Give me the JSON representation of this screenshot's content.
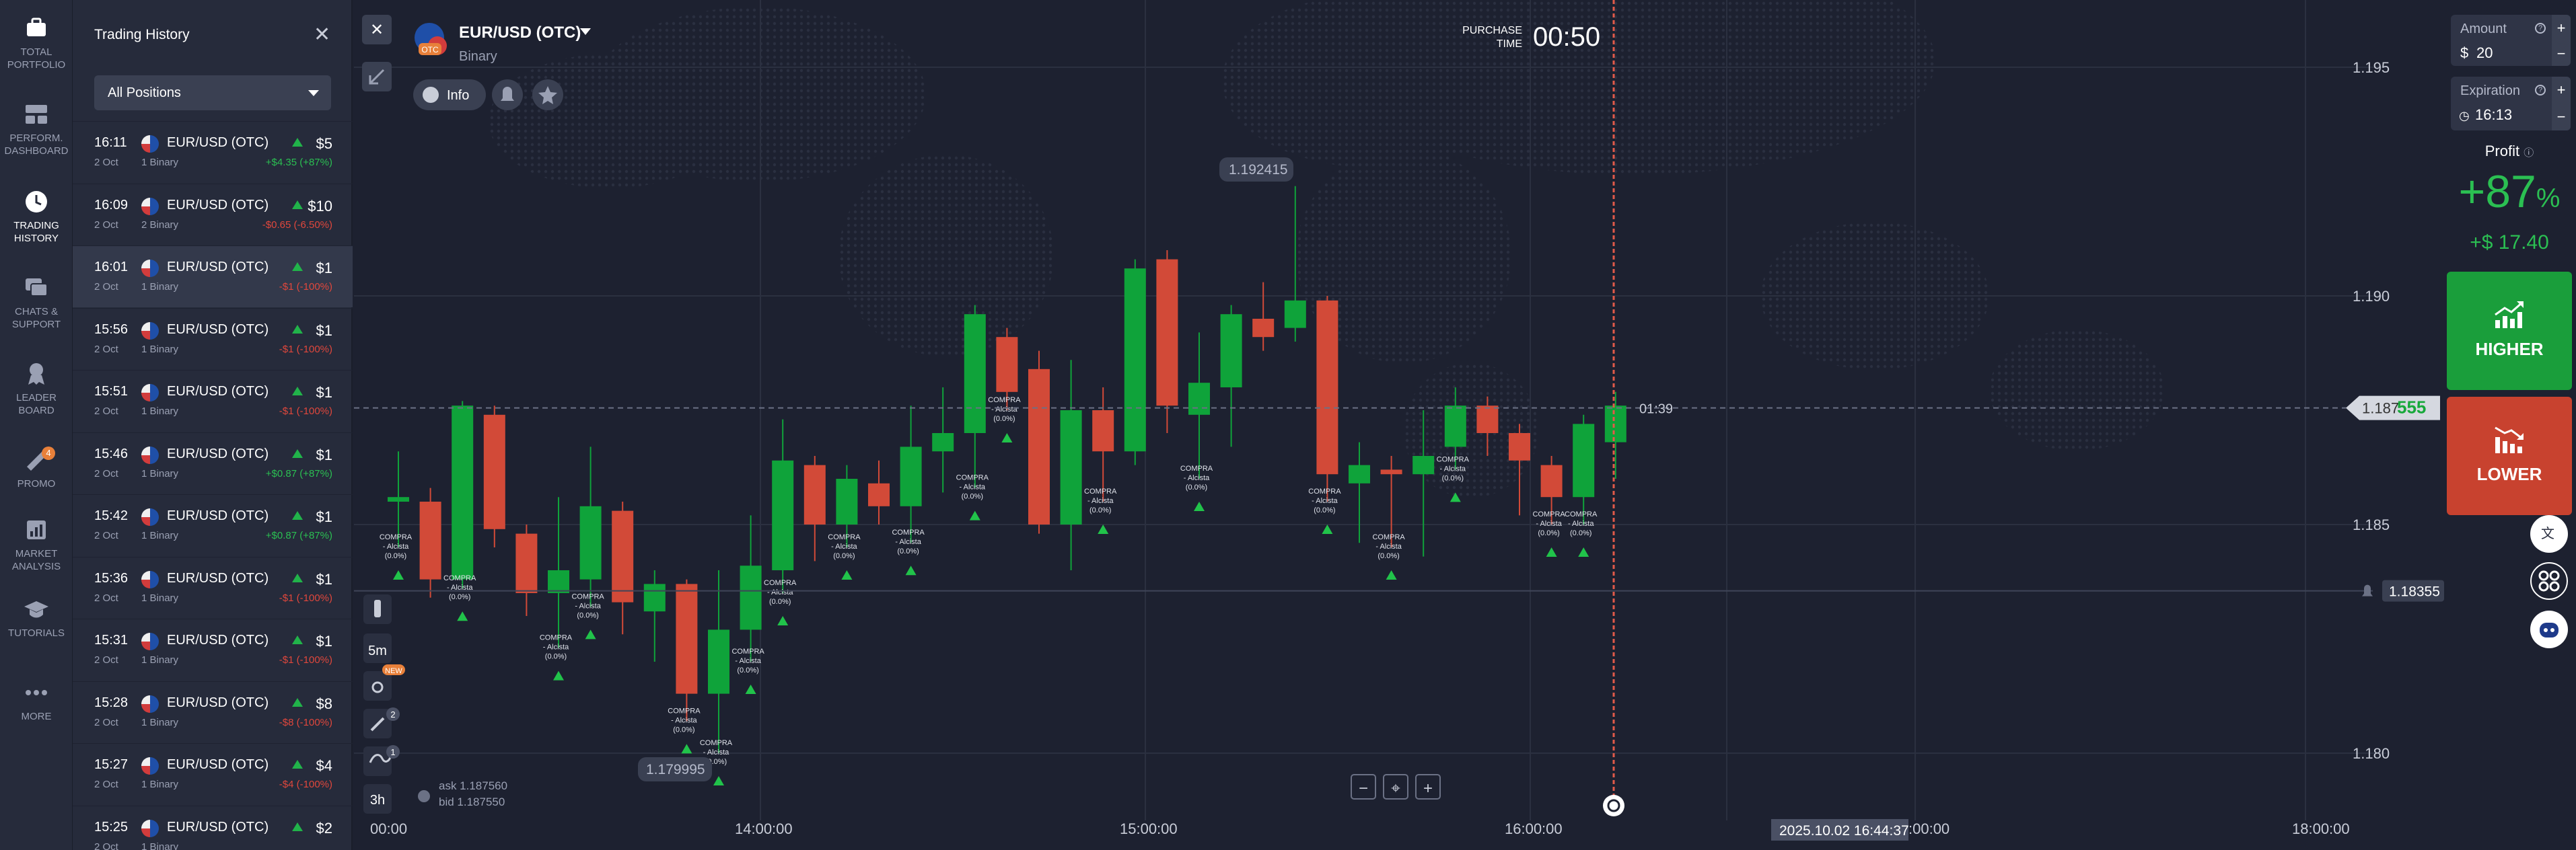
{
  "nav": {
    "items": [
      {
        "label1": "TOTAL",
        "label2": "PORTFOLIO",
        "icon": "briefcase-icon"
      },
      {
        "label1": "PERFORM.",
        "label2": "DASHBOARD",
        "icon": "dashboard-icon"
      },
      {
        "label1": "TRADING",
        "label2": "HISTORY",
        "icon": "clock-icon",
        "active": true
      },
      {
        "label1": "CHATS &",
        "label2": "SUPPORT",
        "icon": "chat-icon"
      },
      {
        "label1": "LEADER",
        "label2": "BOARD",
        "icon": "leaderboard-icon"
      },
      {
        "label1": "PROMO",
        "label2": "",
        "icon": "promo-icon",
        "badge": "4"
      },
      {
        "label1": "MARKET",
        "label2": "ANALYSIS",
        "icon": "analysis-icon"
      },
      {
        "label1": "TUTORIALS",
        "label2": "",
        "icon": "graduation-cap-icon"
      },
      {
        "label1": "MORE",
        "label2": "",
        "icon": "more-dots-icon"
      }
    ]
  },
  "history": {
    "title": "Trading History",
    "close": "✕",
    "filter": "All Positions",
    "rows": [
      {
        "time": "16:11",
        "date": "2 Oct",
        "pair": "EUR/USD (OTC)",
        "kind": "1 Binary",
        "amount": "$5",
        "result": "+$4.35 (+87%)",
        "positive": true
      },
      {
        "time": "16:09",
        "date": "2 Oct",
        "pair": "EUR/USD (OTC)",
        "kind": "2 Binary",
        "amount": "$10",
        "result": "-$0.65 (-6.50%)",
        "positive": false
      },
      {
        "time": "16:01",
        "date": "2 Oct",
        "pair": "EUR/USD (OTC)",
        "kind": "1 Binary",
        "amount": "$1",
        "result": "-$1 (-100%)",
        "positive": false,
        "selected": true
      },
      {
        "time": "15:56",
        "date": "2 Oct",
        "pair": "EUR/USD (OTC)",
        "kind": "1 Binary",
        "amount": "$1",
        "result": "-$1 (-100%)",
        "positive": false
      },
      {
        "time": "15:51",
        "date": "2 Oct",
        "pair": "EUR/USD (OTC)",
        "kind": "1 Binary",
        "amount": "$1",
        "result": "-$1 (-100%)",
        "positive": false
      },
      {
        "time": "15:46",
        "date": "2 Oct",
        "pair": "EUR/USD (OTC)",
        "kind": "1 Binary",
        "amount": "$1",
        "result": "+$0.87 (+87%)",
        "positive": true
      },
      {
        "time": "15:42",
        "date": "2 Oct",
        "pair": "EUR/USD (OTC)",
        "kind": "1 Binary",
        "amount": "$1",
        "result": "+$0.87 (+87%)",
        "positive": true
      },
      {
        "time": "15:36",
        "date": "2 Oct",
        "pair": "EUR/USD (OTC)",
        "kind": "1 Binary",
        "amount": "$1",
        "result": "-$1 (-100%)",
        "positive": false
      },
      {
        "time": "15:31",
        "date": "2 Oct",
        "pair": "EUR/USD (OTC)",
        "kind": "1 Binary",
        "amount": "$1",
        "result": "-$1 (-100%)",
        "positive": false
      },
      {
        "time": "15:28",
        "date": "2 Oct",
        "pair": "EUR/USD (OTC)",
        "kind": "1 Binary",
        "amount": "$8",
        "result": "-$8 (-100%)",
        "positive": false
      },
      {
        "time": "15:27",
        "date": "2 Oct",
        "pair": "EUR/USD (OTC)",
        "kind": "1 Binary",
        "amount": "$4",
        "result": "-$4 (-100%)",
        "positive": false
      },
      {
        "time": "15:25",
        "date": "2 Oct",
        "pair": "EUR/USD (OTC)",
        "kind": "1 Binary",
        "amount": "$2",
        "result": "",
        "positive": false
      }
    ]
  },
  "asset": {
    "name": "EUR/USD (OTC)",
    "type": "Binary",
    "otc_badge": "OTC",
    "info": "Info"
  },
  "purchase": {
    "label1": "PURCHASE",
    "label2": "TIME",
    "value": "00:50"
  },
  "chart_data": {
    "type": "candlestick",
    "y_ticks": [
      "1.195",
      "1.190",
      "1.185",
      "1.180"
    ],
    "x_ticks": [
      "00:00",
      "14:00:00",
      "15:00:00",
      "16:00:00",
      ":00:00",
      "18:00:00"
    ],
    "current_price_main": "1.187",
    "current_price_tail": "555",
    "countdown": "01:39",
    "alert_price": "1.18355",
    "high_label": "1.192415",
    "low_label": "1.179995",
    "cursor_time": "2025.10.02 16:44:37",
    "ask": "ask 1.187560",
    "bid": "bid 1.187550",
    "candles": [
      {
        "o": 1.1855,
        "c": 1.1856,
        "h": 1.1866,
        "l": 1.1845
      },
      {
        "o": 1.1855,
        "c": 1.1838,
        "h": 1.1858,
        "l": 1.1834
      },
      {
        "o": 1.1838,
        "c": 1.1876,
        "h": 1.1877,
        "l": 1.1836
      },
      {
        "o": 1.1874,
        "c": 1.1849,
        "h": 1.1876,
        "l": 1.1845
      },
      {
        "o": 1.1848,
        "c": 1.1835,
        "h": 1.185,
        "l": 1.183
      },
      {
        "o": 1.1835,
        "c": 1.184,
        "h": 1.1856,
        "l": 1.1823
      },
      {
        "o": 1.1838,
        "c": 1.1854,
        "h": 1.1867,
        "l": 1.1832
      },
      {
        "o": 1.1853,
        "c": 1.1833,
        "h": 1.1855,
        "l": 1.1826
      },
      {
        "o": 1.1831,
        "c": 1.1837,
        "h": 1.184,
        "l": 1.182
      },
      {
        "o": 1.1837,
        "c": 1.1813,
        "h": 1.1838,
        "l": 1.1807
      },
      {
        "o": 1.1813,
        "c": 1.1827,
        "h": 1.184,
        "l": 1.18
      },
      {
        "o": 1.1827,
        "c": 1.1841,
        "h": 1.1852,
        "l": 1.182
      },
      {
        "o": 1.184,
        "c": 1.1864,
        "h": 1.1873,
        "l": 1.1835
      },
      {
        "o": 1.1863,
        "c": 1.185,
        "h": 1.1865,
        "l": 1.1842
      },
      {
        "o": 1.185,
        "c": 1.186,
        "h": 1.1863,
        "l": 1.1845
      },
      {
        "o": 1.1859,
        "c": 1.1854,
        "h": 1.1864,
        "l": 1.185
      },
      {
        "o": 1.1854,
        "c": 1.1867,
        "h": 1.1876,
        "l": 1.1846
      },
      {
        "o": 1.1866,
        "c": 1.187,
        "h": 1.188,
        "l": 1.1857
      },
      {
        "o": 1.187,
        "c": 1.1896,
        "h": 1.1898,
        "l": 1.1858
      },
      {
        "o": 1.1891,
        "c": 1.1879,
        "h": 1.1893,
        "l": 1.1875
      },
      {
        "o": 1.1884,
        "c": 1.185,
        "h": 1.1888,
        "l": 1.1848
      },
      {
        "o": 1.185,
        "c": 1.1875,
        "h": 1.1886,
        "l": 1.184
      },
      {
        "o": 1.1875,
        "c": 1.1866,
        "h": 1.188,
        "l": 1.1855
      },
      {
        "o": 1.1866,
        "c": 1.1906,
        "h": 1.1908,
        "l": 1.1863
      },
      {
        "o": 1.1908,
        "c": 1.1876,
        "h": 1.191,
        "l": 1.187
      },
      {
        "o": 1.1874,
        "c": 1.1881,
        "h": 1.1892,
        "l": 1.186
      },
      {
        "o": 1.188,
        "c": 1.1896,
        "h": 1.1898,
        "l": 1.1867
      },
      {
        "o": 1.1895,
        "c": 1.1891,
        "h": 1.1903,
        "l": 1.1888
      },
      {
        "o": 1.1893,
        "c": 1.1899,
        "h": 1.1924,
        "l": 1.189
      },
      {
        "o": 1.1899,
        "c": 1.1861,
        "h": 1.19,
        "l": 1.1855
      },
      {
        "o": 1.1859,
        "c": 1.1863,
        "h": 1.1868,
        "l": 1.1846
      },
      {
        "o": 1.1862,
        "c": 1.1861,
        "h": 1.1865,
        "l": 1.1845
      },
      {
        "o": 1.1861,
        "c": 1.1865,
        "h": 1.1875,
        "l": 1.1843
      },
      {
        "o": 1.1867,
        "c": 1.1876,
        "h": 1.188,
        "l": 1.1862
      },
      {
        "o": 1.1876,
        "c": 1.187,
        "h": 1.1878,
        "l": 1.1865
      },
      {
        "o": 1.187,
        "c": 1.1864,
        "h": 1.1872,
        "l": 1.1852
      },
      {
        "o": 1.1863,
        "c": 1.1856,
        "h": 1.1865,
        "l": 1.185
      },
      {
        "o": 1.1856,
        "c": 1.1872,
        "h": 1.1874,
        "l": 1.185
      },
      {
        "o": 1.1868,
        "c": 1.1876,
        "h": 1.1879,
        "l": 1.186
      }
    ],
    "trade_label": [
      "COMPRA",
      "- Alcista",
      "(0.0%)"
    ]
  },
  "zoom": {
    "minus": "−",
    "target": "⌖",
    "plus": "+"
  },
  "tools": {
    "tf1": "5m",
    "tf2": "3h",
    "new_badge": "NEW",
    "badge2": "2",
    "badge1": "1"
  },
  "amount": {
    "label": "Amount",
    "currency": "$",
    "value": "20",
    "plus": "+",
    "minus": "−"
  },
  "expiration": {
    "label": "Expiration",
    "value": "16:13",
    "plus": "+",
    "minus": "−"
  },
  "profit": {
    "label": "Profit",
    "percent": "+87",
    "pct_sign": "%",
    "amount": "+$ 17.40"
  },
  "higher": "HIGHER",
  "lower": "LOWER",
  "colors": {
    "up": "#0fa33a",
    "down": "#d24a38",
    "bg": "#1d2130",
    "panel": "#262b3b"
  }
}
